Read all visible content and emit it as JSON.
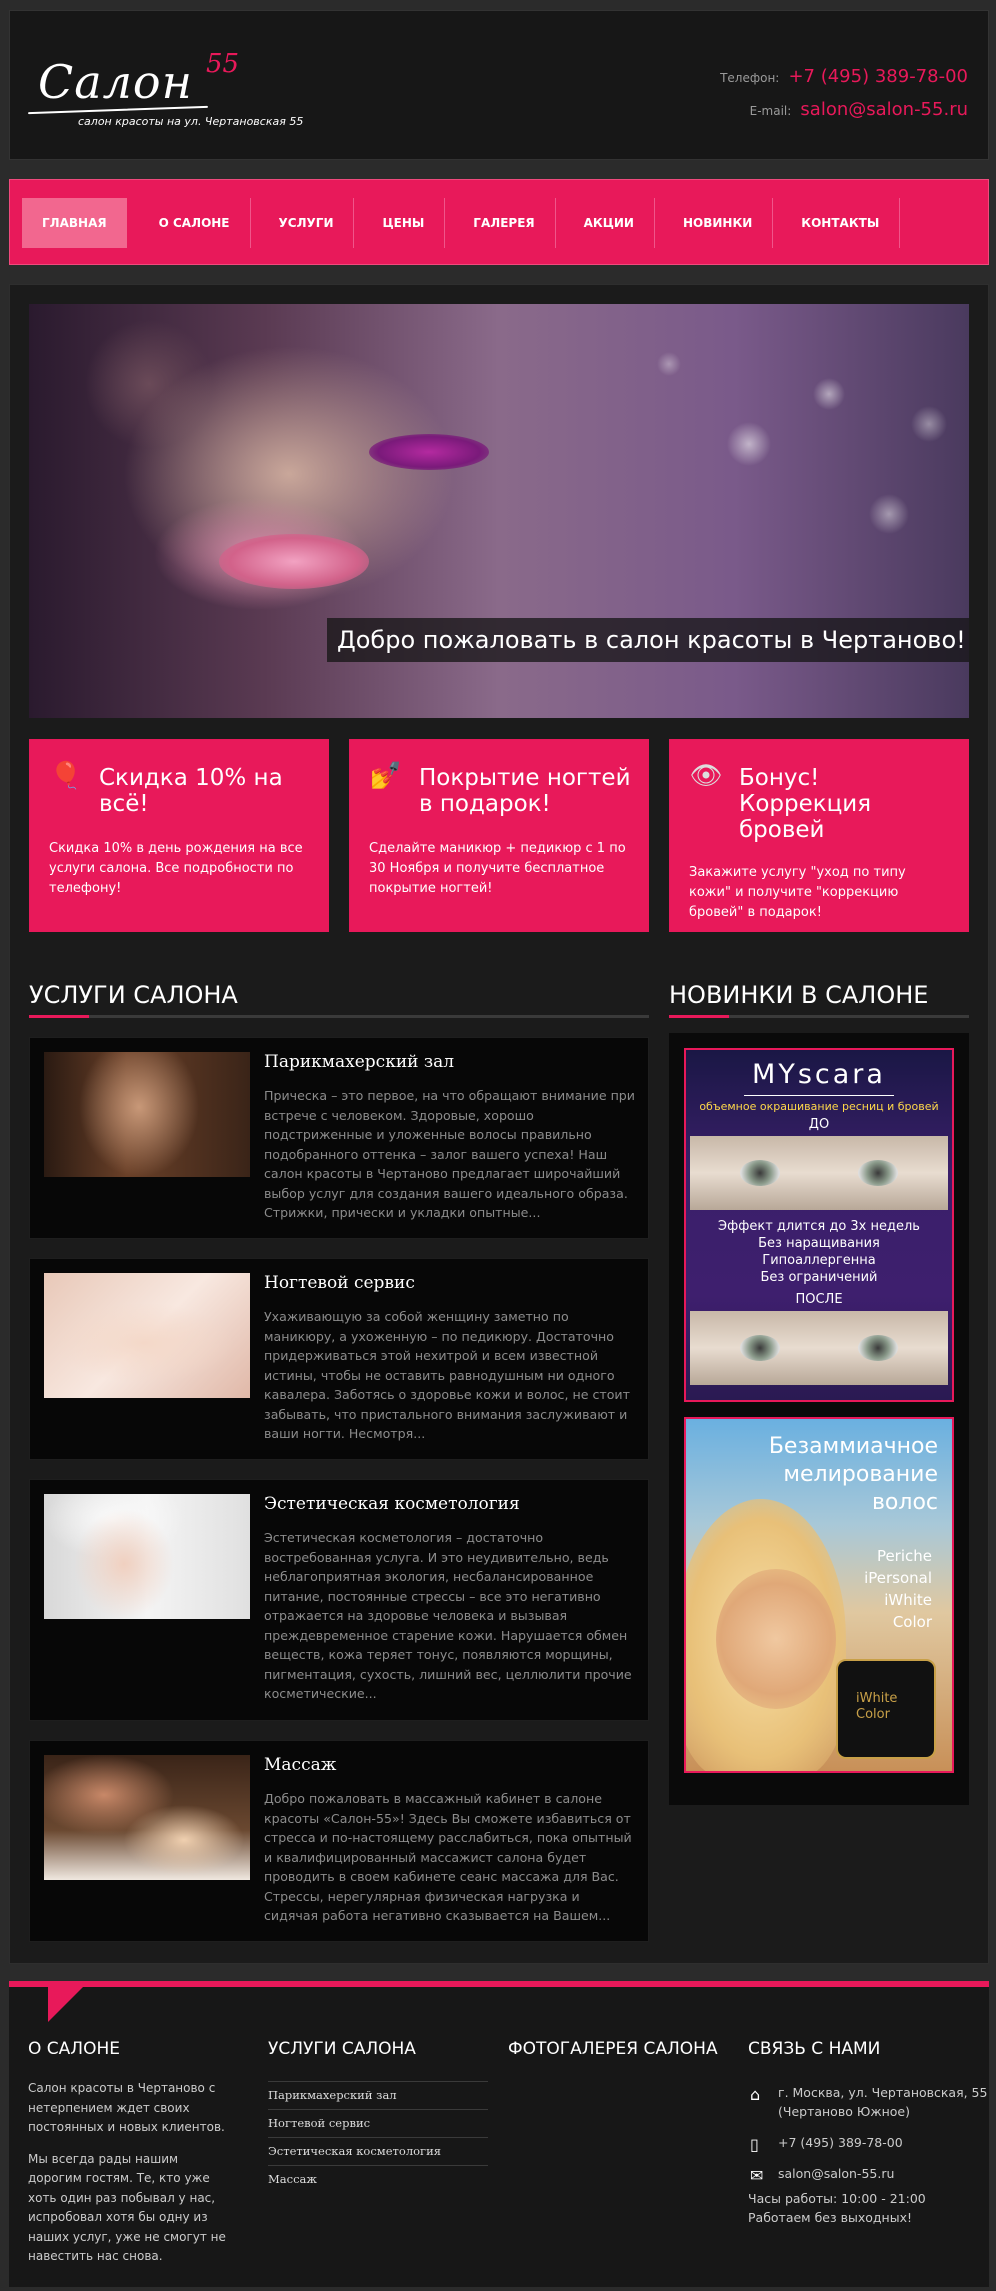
{
  "header": {
    "logo_script": "Салон",
    "logo_number": "55",
    "logo_subtitle": "салон красоты на ул. Чертановская 55",
    "phone_label": "Телефон:",
    "phone": "+7 (495) 389-78-00",
    "email_label": "E-mail:",
    "email": "salon@salon-55.ru"
  },
  "nav": {
    "items": [
      {
        "label": "ГЛАВНАЯ"
      },
      {
        "label": "О САЛОНЕ"
      },
      {
        "label": "УСЛУГИ"
      },
      {
        "label": "ЦЕНЫ"
      },
      {
        "label": "ГАЛЕРЕЯ"
      },
      {
        "label": "АКЦИИ"
      },
      {
        "label": "НОВИНКИ"
      },
      {
        "label": "КОНТАКТЫ"
      }
    ],
    "active": "ГЛАВНАЯ"
  },
  "hero": {
    "caption": "Добро пожаловать в салон красоты в Чертаново!"
  },
  "promos": [
    {
      "icon": "balloons-icon",
      "title": "Скидка 10% на всё!",
      "text": "Скидка 10% в день рождения на все услуги салона. Все подробности по телефону!"
    },
    {
      "icon": "nail-polish-icon",
      "title": "Покрытие ногтей в подарок!",
      "text": "Сделайте маникюр + педикюр с 1 по 30 Ноября и получите бесплатное покрытие ногтей!"
    },
    {
      "icon": "eye-icon",
      "title": "Бонус! Коррекция бровей",
      "text": "Закажите услугу \"уход по типу кожи\" и получите \"коррекцию бровей\" в подарок!"
    }
  ],
  "services": {
    "title": "УСЛУГИ САЛОНА",
    "items": [
      {
        "title": "Парикмахерский зал",
        "text": "Прическа – это первое, на что обращают внимание при встрече с человеком. Здоровые, хорошо подстриженные и уложенные волосы правильно подобранного оттенка – залог вашего успеха! Наш салон красоты в Чертаново предлагает широчайший выбор услуг для создания вашего идеального образа. Стрижки, прически и укладки опытные..."
      },
      {
        "title": "Ногтевой сервис",
        "text": "Ухаживающую за собой женщину заметно по маникюру, а ухоженную – по педикюру. Достаточно придерживаться этой нехитрой и всем известной истины, чтобы не оставить равнодушным ни одного кавалера. Заботясь о здоровье кожи и волос, не стоит забывать, что пристального внимания заслуживают и ваши ногти. Несмотря..."
      },
      {
        "title": "Эстетическая косметология",
        "text": "Эстетическая косметология – достаточно востребованная услуга. И это неудивительно, ведь неблагоприятная экология, несбалансированное питание, постоянные стрессы – все это негативно отражается на здоровье человека и вызывая преждевременное старение кожи. Нарушается обмен веществ, кожа теряет тонус, появляются морщины, пигментация, сухость, лишний вес, целлюлити прочие косметические..."
      },
      {
        "title": "Массаж",
        "text": "Добро пожаловать в массажный кабинет в салоне красоты «Салон-55»! Здесь Вы сможете избавиться от стресса и по-настоящему расслабиться, пока опытный и квалифицированный массажист салона будет проводить в своем кабинете сеанс массажа для Вас. Стрессы, нерегулярная физическая нагрузка и сидячая работа негативно сказывается на Вашем..."
      }
    ]
  },
  "news": {
    "title": "НОВИНКИ В САЛОНЕ",
    "banner1": {
      "brand": "MYscara",
      "tagline": "объемное окрашивание ресниц и бровей",
      "before": "ДО",
      "lines": [
        "Эффект длится до 3х недель",
        "Без наращивания",
        "Гипоаллергенна",
        "Без ограничений"
      ],
      "after": "ПОСЛЕ"
    },
    "banner2": {
      "title_lines": [
        "Безаммиачное",
        "мелирование",
        "волос"
      ],
      "list": [
        "Periche",
        "iPersonal",
        "iWhite",
        "Color"
      ],
      "jar_label": "iWhite Color"
    }
  },
  "footer": {
    "about": {
      "title": "О САЛОНЕ",
      "p1": "Салон красоты в Чертаново с нетерпением ждет своих постоянных и новых клиентов.",
      "p2": "Мы всегда рады нашим дорогим гостям. Те, кто уже хоть один раз побывал у нас, испробовал хотя бы одну из наших услуг, уже не смогут не навестить нас снова."
    },
    "services": {
      "title": "УСЛУГИ САЛОНА",
      "links": [
        "Парикмахерский зал",
        "Ногтевой сервис",
        "Эстетическая косметология",
        "Массаж"
      ]
    },
    "gallery": {
      "title": "ФОТОГАЛЕРЕЯ САЛОНА"
    },
    "contacts": {
      "title": "СВЯЗЬ С НАМИ",
      "address": "г. Москва, ул. Чертановская, 55 (Чертаново Южное)",
      "phone": "+7 (495) 389-78-00",
      "email": "salon@salon-55.ru",
      "hours": "Часы работы: 10:00 - 21:00",
      "days": "Работаем без выходных!"
    }
  }
}
